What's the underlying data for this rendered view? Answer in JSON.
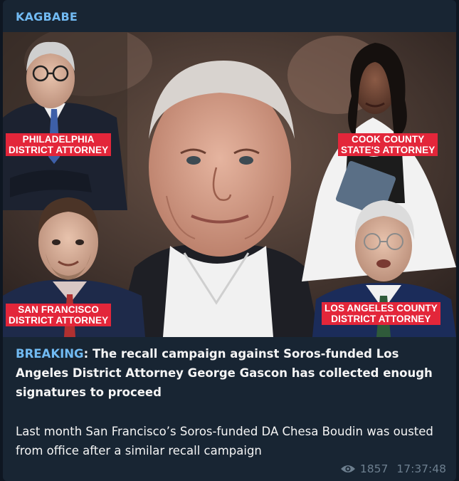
{
  "channel": {
    "name": "KAGBABE"
  },
  "photo": {
    "labels": {
      "philadelphia": [
        "PHILADELPHIA",
        "DISTRICT ATTORNEY"
      ],
      "cook_county": [
        "COOK COUNTY",
        "STATE'S ATTORNEY"
      ],
      "san_francisco": [
        "SAN FRANCISCO",
        "DISTRICT ATTORNEY"
      ],
      "los_angeles": [
        "LOS ANGELES COUNTY",
        "DISTRICT ATTORNEY"
      ]
    },
    "label_color": "#e3263a"
  },
  "post": {
    "breaking_tag": "BREAKING",
    "headline": ": The recall campaign against Soros-funded Los Angeles District Attorney George Gascon has collected enough signatures to proceed",
    "body": "Last month San Francisco’s Soros-funded DA Chesa Boudin was ousted from office after a similar recall campaign"
  },
  "meta": {
    "views_icon": "eye-icon",
    "views": "1857",
    "time": "17:37:48"
  },
  "colors": {
    "background": "#0e1621",
    "bubble": "#182533",
    "accent": "#71baf2",
    "meta": "#6d7f8f"
  }
}
